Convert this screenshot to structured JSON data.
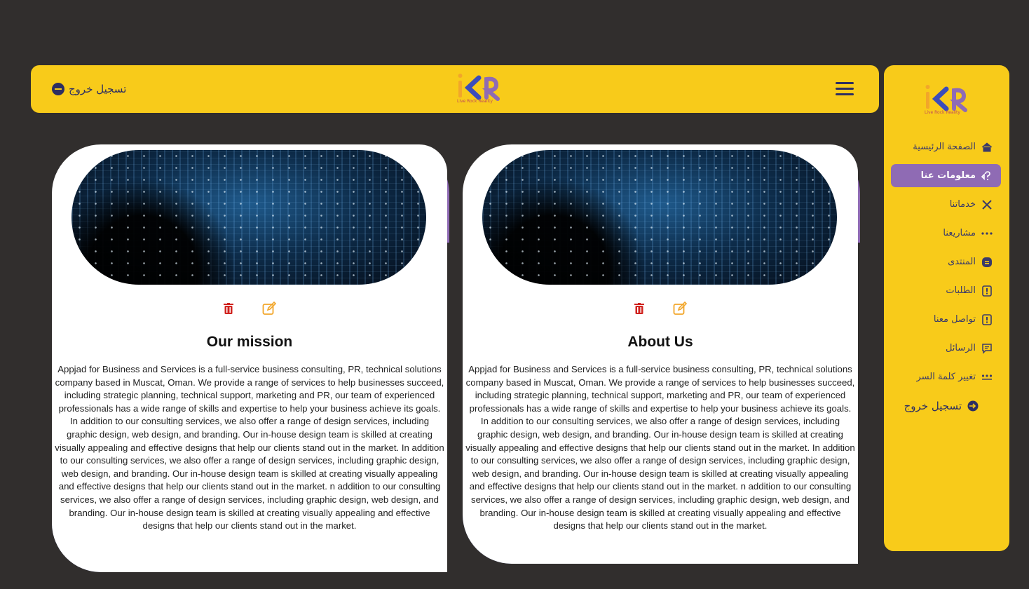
{
  "topbar": {
    "logout_label": "تسجيل خروج",
    "logo": {
      "tagline": "Live  Rock  Reality"
    }
  },
  "sidebar": {
    "logo": {
      "tagline": "Live  Rock  Reality"
    },
    "items": [
      {
        "label": "الصفحة الرئيسية",
        "icon": "home-icon",
        "active": false
      },
      {
        "label": "معلومات عنا",
        "icon": "question-icon",
        "active": true
      },
      {
        "label": "خدماتنا",
        "icon": "tools-icon",
        "active": false
      },
      {
        "label": "مشاريعنا",
        "icon": "dots-icon",
        "active": false
      },
      {
        "label": "المنتدى",
        "icon": "blog-icon",
        "active": false
      },
      {
        "label": "الطلبات",
        "icon": "order-icon",
        "active": false
      },
      {
        "label": "تواصل معنا",
        "icon": "contact-icon",
        "active": false
      },
      {
        "label": "الرسائل",
        "icon": "message-icon",
        "active": false
      },
      {
        "label": "تغيير كلمة السر",
        "icon": "password-icon",
        "active": false
      }
    ],
    "logout_label": "تسجيل خروج"
  },
  "cards": [
    {
      "title": "Our mission",
      "body": "Appjad for Business and Services is a full-service business consulting, PR, technical solutions company based in Muscat, Oman. We provide a range of services to help businesses succeed, including strategic planning, technical support, marketing and PR, our team of experienced professionals has a wide range of skills and expertise to help your business achieve its goals. In addition to our consulting services, we also offer a range of design services, including graphic design, web design, and branding. Our in-house design team is skilled at creating visually appealing and effective designs that help our clients stand out in the market. In addition to our consulting services, we also offer a range of design services, including graphic design, web design, and branding. Our in-house design team is skilled at creating visually appealing and effective designs that help our clients stand out in the market. n addition to our consulting services, we also offer a range of design services, including graphic design, web design, and branding. Our in-house design team is skilled at creating visually appealing and effective designs that help our clients stand out in the market."
    },
    {
      "title": "About Us",
      "body": "Appjad for Business and Services is a full-service business consulting, PR, technical solutions company based in Muscat, Oman. We provide a range of services to help businesses succeed, including strategic planning, technical support, marketing and PR, our team of experienced professionals has a wide range of skills and expertise to help your business achieve its goals. In addition to our consulting services, we also offer a range of design services, including graphic design, web design, and branding. Our in-house design team is skilled at creating visually appealing and effective designs that help our clients stand out in the market. In addition to our consulting services, we also offer a range of design services, including graphic design, web design, and branding. Our in-house design team is skilled at creating visually appealing and effective designs that help our clients stand out in the market. n addition to our consulting services, we also offer a range of design services, including graphic design, web design, and branding. Our in-house design team is skilled at creating visually appealing and effective designs that help our clients stand out in the market."
    }
  ],
  "colors": {
    "background": "#312e2d",
    "accent_yellow": "#f8cb1a",
    "accent_purple": "#8f6bb4",
    "accent_blue": "#3b4f9a",
    "delete_red": "#d0231f",
    "edit_orange": "#f2a62a"
  }
}
